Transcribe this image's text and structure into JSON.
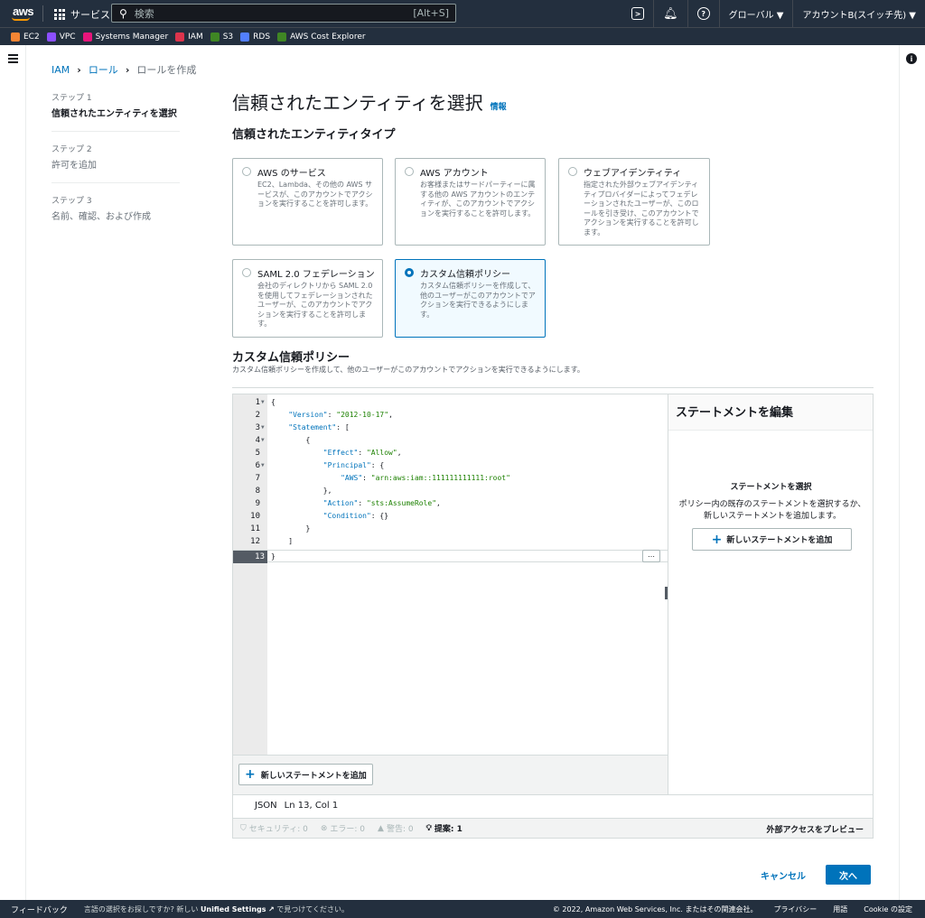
{
  "topnav": {
    "logo": "aws",
    "services": "サービス",
    "search_placeholder": "検索",
    "search_shortcut": "[Alt+S]",
    "region": "グローバル ▼",
    "account": "アカウントB(スイッチ先) ▼",
    "icons": [
      "cloudshell-icon",
      "bell-icon",
      "help-icon"
    ]
  },
  "favorites": [
    {
      "label": "EC2",
      "color": "#f58534"
    },
    {
      "label": "VPC",
      "color": "#8c4fff"
    },
    {
      "label": "Systems Manager",
      "color": "#e7157b"
    },
    {
      "label": "IAM",
      "color": "#dd344c"
    },
    {
      "label": "S3",
      "color": "#3f8624"
    },
    {
      "label": "RDS",
      "color": "#527fff"
    },
    {
      "label": "AWS Cost Explorer",
      "color": "#3f8624"
    }
  ],
  "breadcrumb": {
    "iam": "IAM",
    "roles": "ロール",
    "current": "ロールを作成"
  },
  "steps": [
    {
      "num": "ステップ 1",
      "label": "信頼されたエンティティを選択"
    },
    {
      "num": "ステップ 2",
      "label": "許可を追加"
    },
    {
      "num": "ステップ 3",
      "label": "名前、確認、および作成"
    }
  ],
  "page": {
    "title": "信頼されたエンティティを選択",
    "info": "情報",
    "section_title": "信頼されたエンティティタイプ"
  },
  "tiles": [
    {
      "title": "AWS のサービス",
      "desc": "EC2、Lambda、その他の AWS サービスが、このアカウントでアクションを実行することを許可します。",
      "selected": false
    },
    {
      "title": "AWS アカウント",
      "desc": "お客様またはサードパーティーに属する他の AWS アカウントのエンティティが、このアカウントでアクションを実行することを許可します。",
      "selected": false
    },
    {
      "title": "ウェブアイデンティティ",
      "desc": "指定された外部ウェブアイデンティティプロバイダーによってフェデレーションされたユーザーが、このロールを引き受け、このアカウントでアクションを実行することを許可します。",
      "selected": false
    },
    {
      "title": "SAML 2.0 フェデレーション",
      "desc": "会社のディレクトリから SAML 2.0 を使用してフェデレーションされたユーザーが、このアカウントでアクションを実行することを許可します。",
      "selected": false
    },
    {
      "title": "カスタム信頼ポリシー",
      "desc": "カスタム信頼ポリシーを作成して、他のユーザーがこのアカウントでアクションを実行できるようにします。",
      "selected": true
    }
  ],
  "custom_policy": {
    "title": "カスタム信頼ポリシー",
    "desc": "カスタム信頼ポリシーを作成して、他のユーザーがこのアカウントでアクションを実行できるようにします。"
  },
  "editor": {
    "lines": [
      "1",
      "2",
      "3",
      "4",
      "5",
      "6",
      "7",
      "8",
      "9",
      "10",
      "11",
      "12",
      "13"
    ],
    "add_statement": "新しいステートメントを追加",
    "ellipsis": "…",
    "status_lang": "JSON",
    "status_pos": "Ln 13, Col 1"
  },
  "right_panel": {
    "title": "ステートメントを編集",
    "subtitle": "ステートメントを選択",
    "desc": "ポリシー内の既存のステートメントを選択するか、新しいステートメントを追加します。",
    "button": "新しいステートメントを追加"
  },
  "lint": {
    "security": "セキュリティ: 0",
    "errors": "エラー: 0",
    "warnings": "警告: 0",
    "suggestions": "提案: 1",
    "preview": "外部アクセスをプレビュー"
  },
  "actions": {
    "cancel": "キャンセル",
    "next": "次へ"
  },
  "footer": {
    "feedback": "フィードバック",
    "lang_prefix": "言語の選択をお探しですか? 新しい",
    "lang_link": "Unified Settings",
    "lang_suffix": "で見つけてください。",
    "copyright": "© 2022, Amazon Web Services, Inc. またはその関連会社。",
    "privacy": "プライバシー",
    "terms": "用語",
    "cookie": "Cookie の設定"
  }
}
